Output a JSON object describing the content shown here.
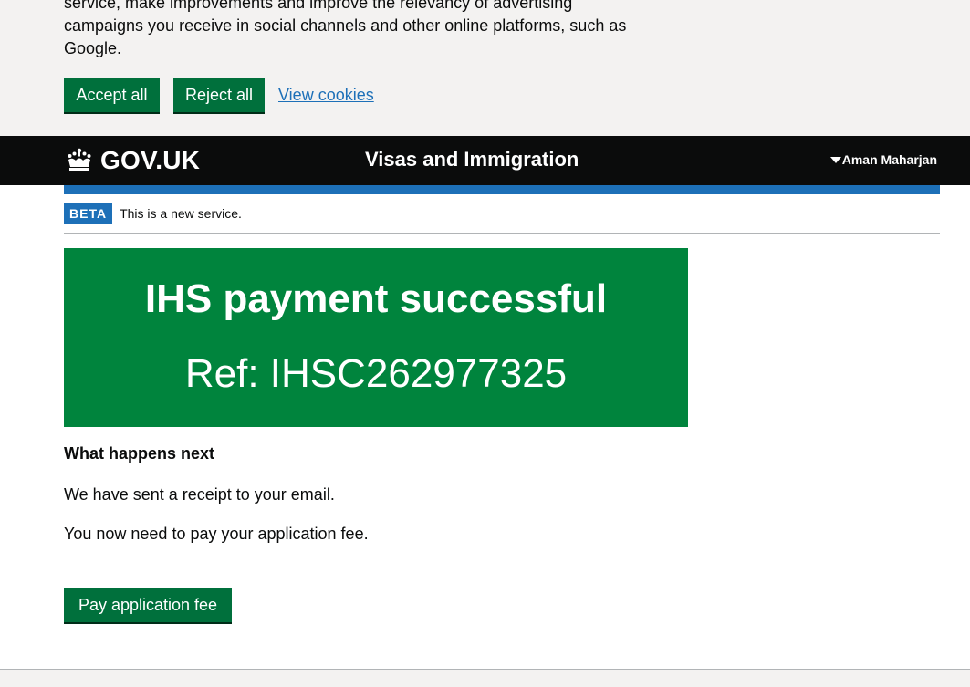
{
  "cookie_banner": {
    "text_lines": [
      "service, make improvements and improve the relevancy of advertising",
      "campaigns you receive in social channels and other online platforms, such as",
      "Google."
    ],
    "accept_label": "Accept all",
    "reject_label": "Reject all",
    "view_label": "View cookies"
  },
  "header": {
    "logo_text": "GOV.UK",
    "logo_icon": "crown-icon",
    "service_name": "Visas and Immigration",
    "account_name": "Aman Maharjan",
    "account_icon": "caret-down-icon"
  },
  "phase_banner": {
    "tag": "BETA",
    "text": "This is a new service."
  },
  "panel": {
    "title": "IHS payment successful",
    "reference": "Ref: IHSC262977325"
  },
  "main": {
    "next_heading": "What happens next",
    "paragraphs": [
      "We have sent a receipt to your email.",
      "You now need to pay your application fee."
    ],
    "pay_button": "Pay application fee"
  },
  "colors": {
    "header_bg": "#0b0c0c",
    "button_green": "#00703c",
    "panel_green": "#00843d",
    "link_blue": "#1d70b8"
  }
}
